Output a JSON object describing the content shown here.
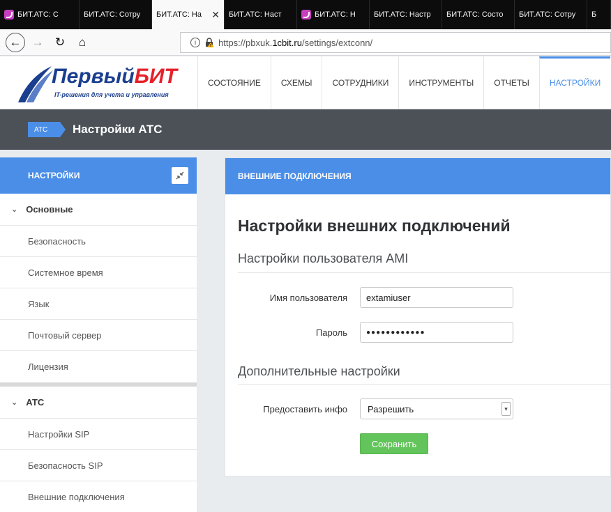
{
  "browser": {
    "tabs": [
      {
        "label": "БИТ.АТС: С",
        "favicon": true,
        "active": false
      },
      {
        "label": "БИТ.АТС: Сотру",
        "favicon": false,
        "active": false
      },
      {
        "label": "БИТ.АТС: На",
        "favicon": false,
        "active": true
      },
      {
        "label": "БИТ.АТС: Наст",
        "favicon": false,
        "active": false
      },
      {
        "label": "БИТ.АТС: Н",
        "favicon": true,
        "active": false
      },
      {
        "label": "БИТ.АТС: Настр",
        "favicon": false,
        "active": false
      },
      {
        "label": "БИТ.АТС: Состо",
        "favicon": false,
        "active": false
      },
      {
        "label": "БИТ.АТС: Сотру",
        "favicon": false,
        "active": false
      },
      {
        "label": "Б",
        "favicon": false,
        "active": false
      }
    ],
    "url_prefix": "https://pbxuk.",
    "url_host": "1cbit.ru",
    "url_path": "/settings/extconn/"
  },
  "header": {
    "logo_main": "Первый",
    "logo_accent": "БИТ",
    "logo_tagline": "IT-решения для учета и управления",
    "menu": [
      {
        "label": "СОСТОЯНИЕ",
        "active": false
      },
      {
        "label": "СХЕМЫ",
        "active": false
      },
      {
        "label": "СОТРУДНИКИ",
        "active": false
      },
      {
        "label": "ИНСТРУМЕНТЫ",
        "active": false
      },
      {
        "label": "ОТЧЕТЫ",
        "active": false
      },
      {
        "label": "НАСТРОЙКИ",
        "active": true
      }
    ]
  },
  "titlebar": {
    "badge": "АТС",
    "title": "Настройки АТС"
  },
  "sidebar": {
    "title": "НАСТРОЙКИ",
    "group1": "Основные",
    "group1_items": [
      "Безопасность",
      "Системное время",
      "Язык",
      "Почтовый сервер",
      "Лицензия"
    ],
    "group2": "АТС",
    "group2_items": [
      "Настройки SIP",
      "Безопасность SIP",
      "Внешние подключения"
    ]
  },
  "main": {
    "panel_title": "ВНЕШНИЕ ПОДКЛЮЧЕНИЯ",
    "heading": "Настройки внешних подключений",
    "section_ami": "Настройки пользователя AMI",
    "username_label": "Имя пользователя",
    "username_value": "extamiuser",
    "password_label": "Пароль",
    "password_value": "●●●●●●●●●●●●",
    "section_extra": "Дополнительные настройки",
    "info_label": "Предоставить инфо",
    "info_value": "Разрешить",
    "save_label": "Сохранить"
  },
  "colors": {
    "accent": "#4a8ee8",
    "titlebar": "#4b5157",
    "save": "#62c45a",
    "logo_blue": "#1b3f8f",
    "logo_red": "#e6202a",
    "tab_bg": "#0c0c0d"
  }
}
